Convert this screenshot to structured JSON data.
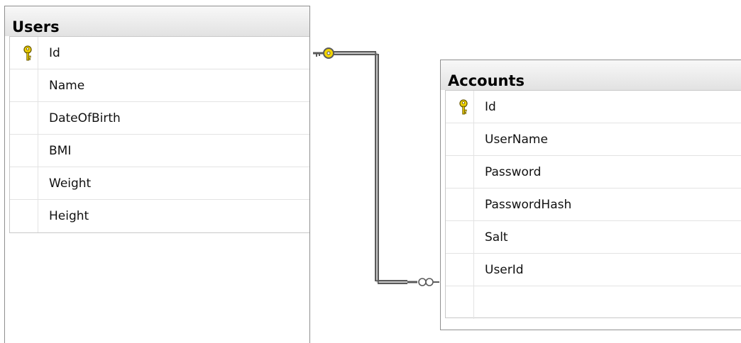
{
  "tables": [
    {
      "id": "users",
      "title": "Users",
      "columns": [
        {
          "name": "Id",
          "primary_key": true
        },
        {
          "name": "Name",
          "primary_key": false
        },
        {
          "name": "DateOfBirth",
          "primary_key": false
        },
        {
          "name": "BMI",
          "primary_key": false
        },
        {
          "name": "Weight",
          "primary_key": false
        },
        {
          "name": "Height",
          "primary_key": false
        }
      ]
    },
    {
      "id": "accounts",
      "title": "Accounts",
      "columns": [
        {
          "name": "Id",
          "primary_key": true
        },
        {
          "name": "UserName",
          "primary_key": false
        },
        {
          "name": "Password",
          "primary_key": false
        },
        {
          "name": "PasswordHash",
          "primary_key": false
        },
        {
          "name": "Salt",
          "primary_key": false
        },
        {
          "name": "UserId",
          "primary_key": false
        }
      ]
    }
  ],
  "relationship": {
    "from_table": "Users",
    "from_end": "key-icon",
    "to_table": "Accounts",
    "to_end": "infinity-icon"
  },
  "colors": {
    "key_icon": "#e8c800",
    "connector": "#555555",
    "table_border": "#8f8f8f"
  }
}
